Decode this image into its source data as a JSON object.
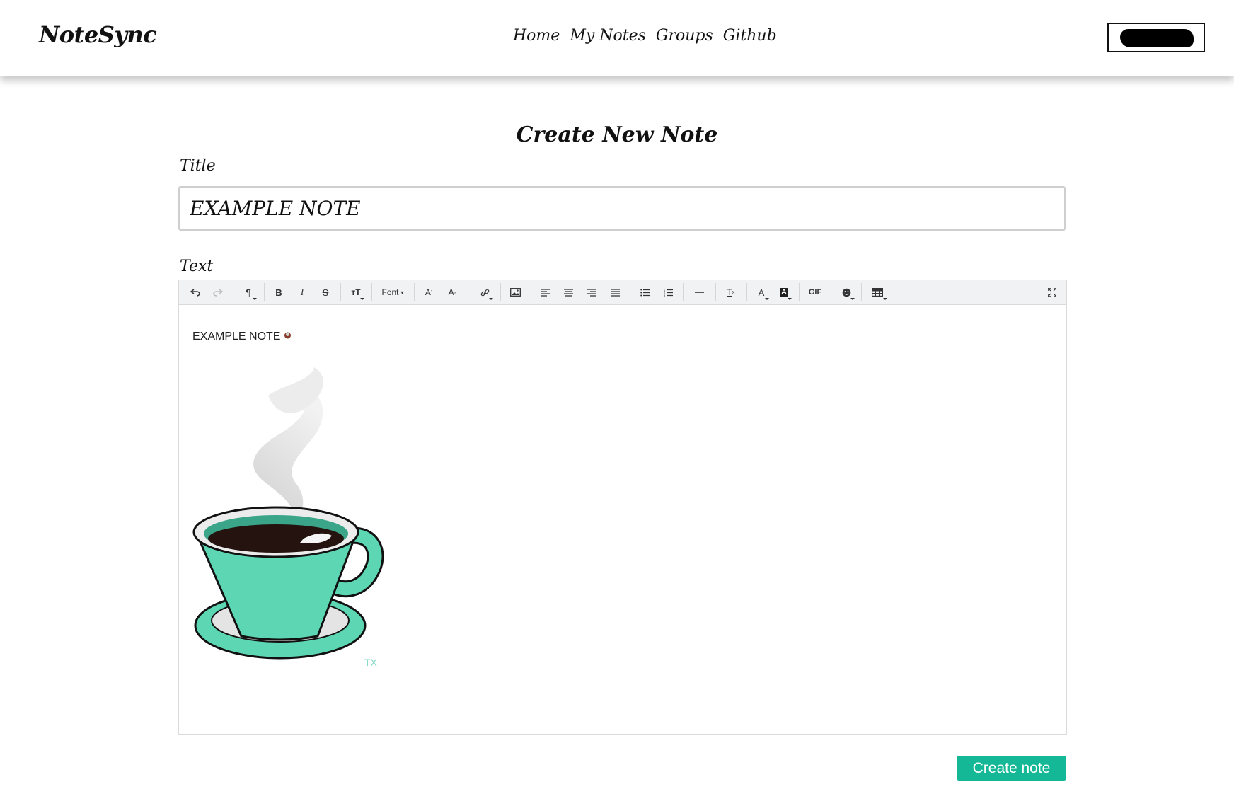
{
  "navbar": {
    "brand": "NoteSync",
    "links": [
      "Home",
      "My Notes",
      "Groups",
      "Github"
    ]
  },
  "page": {
    "title": "Create New Note"
  },
  "form": {
    "title_label": "Title",
    "title_value": "EXAMPLE NOTE",
    "text_label": "Text",
    "submit_label": "Create note"
  },
  "toolbar": {
    "font_label": "Font",
    "gif_label": "GIF",
    "icons": [
      "undo-icon",
      "redo-icon",
      "paragraph-icon",
      "bold-icon",
      "italic-icon",
      "strikethrough-icon",
      "font-size-icon",
      "superscript-icon",
      "subscript-icon",
      "link-icon",
      "image-icon",
      "align-left-icon",
      "align-center-icon",
      "align-right-icon",
      "align-justify-icon",
      "bullet-list-icon",
      "numbered-list-icon",
      "horizontal-rule-icon",
      "clear-format-icon",
      "text-color-icon",
      "highlight-color-icon",
      "emoji-icon",
      "table-icon",
      "fullscreen-icon"
    ]
  },
  "editor": {
    "body_text": "EXAMPLE NOTE"
  },
  "colors": {
    "accent": "#14b896",
    "cup": "#5dd6b3",
    "toolbar_bg": "#f0f2f4"
  }
}
